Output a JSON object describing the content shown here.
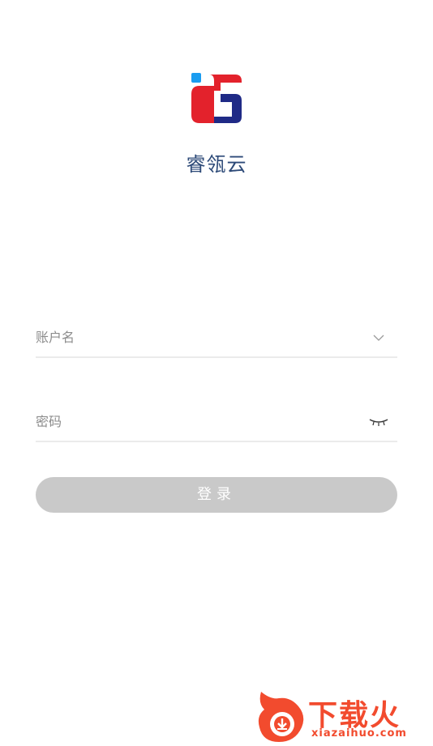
{
  "app": {
    "name": "睿瓴云"
  },
  "login_form": {
    "account_placeholder": "账户名",
    "password_placeholder": "密码",
    "submit_label": "登录"
  },
  "watermark": {
    "text": "下载火",
    "url": "xiazaihuo.com"
  },
  "icons": {
    "account_dropdown": "chevron-down-icon",
    "password_visibility": "eye-closed-icon"
  },
  "colors": {
    "logo_red": "#e3222c",
    "logo_blue": "#1f2a86",
    "logo_dot": "#1a9cf0",
    "title_text": "#2d4a78",
    "button_disabled": "#c9c9c9",
    "watermark": "#f24b2e"
  }
}
